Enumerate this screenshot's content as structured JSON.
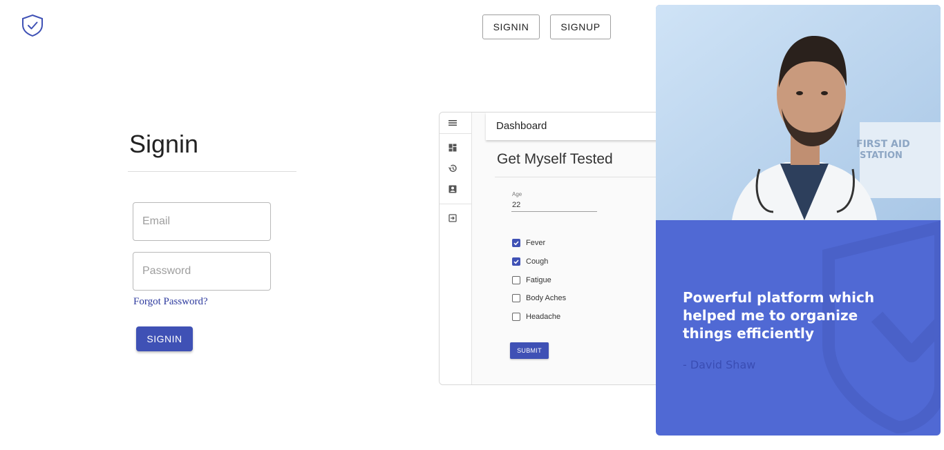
{
  "nav": {
    "signin_label": "SIGNIN",
    "signup_label": "SIGNUP"
  },
  "form": {
    "title": "Signin",
    "email_placeholder": "Email",
    "password_placeholder": "Password",
    "forgot_label": "Forgot Password?",
    "submit_label": "SIGNIN"
  },
  "preview": {
    "header_title": "Dashboard",
    "page_title": "Get Myself Tested",
    "age_label": "Age",
    "age_value": "22",
    "symptoms": [
      {
        "label": "Fever",
        "checked": true
      },
      {
        "label": "Cough",
        "checked": true
      },
      {
        "label": "Fatigue",
        "checked": false
      },
      {
        "label": "Body Aches",
        "checked": false
      },
      {
        "label": "Headache",
        "checked": false
      }
    ],
    "submit_label": "SUBMIT"
  },
  "testimonial": {
    "quote": "Powerful platform which helped me to organize things efficiently",
    "author": "- David Shaw",
    "photo_sign": "FIRST AID STATION"
  },
  "colors": {
    "primary": "#3f51b5",
    "card_blue": "#5069d4",
    "link": "#2d3a9e"
  }
}
